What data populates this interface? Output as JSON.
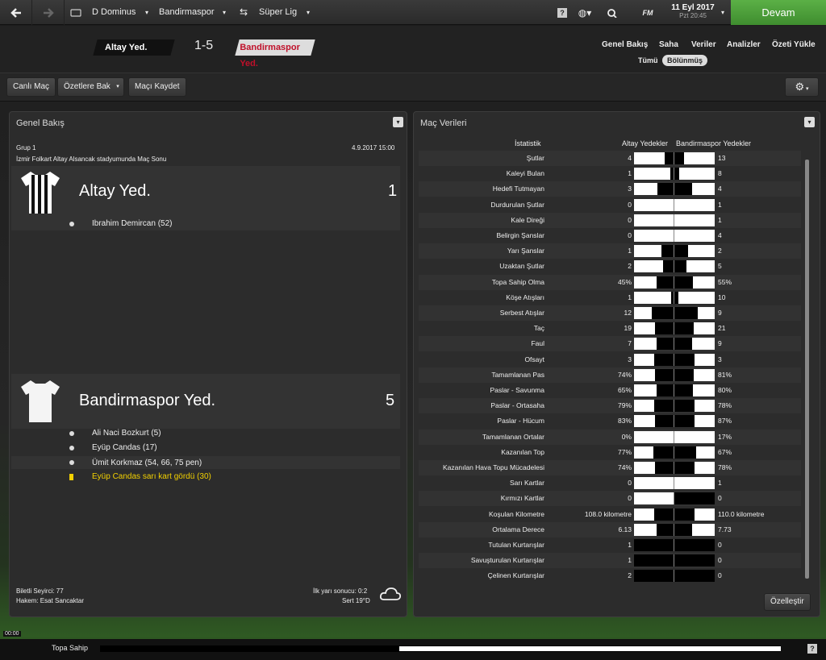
{
  "topbar": {
    "manager": "D Dominus",
    "club": "Bandirmaspor",
    "competition": "Süper Lig",
    "date": "11 Eyl 2017",
    "time": "Pzt 20:45",
    "continue": "Devam",
    "fm_label": "FM"
  },
  "match": {
    "home": "Altay Yed.",
    "away": "Bandirmaspor Yed.",
    "score": "1-5"
  },
  "nav": {
    "items": [
      "Genel Bakış",
      "Saha",
      "Veriler",
      "Analizler",
      "Özeti Yükle"
    ],
    "sub": [
      "Tümü",
      "Bölünmüş"
    ]
  },
  "toolbar": {
    "live": "Canlı Maç",
    "highlights": "Özetlere Bak",
    "save": "Maçı Kaydet"
  },
  "overview": {
    "title": "Genel Bakış",
    "group": "Grup 1",
    "datetime": "4.9.2017 15:00",
    "venue": "İzmir Folkart Altay Alsancak stadyumunda Maç Sonu",
    "home": {
      "name": "Altay Yed.",
      "score": "1",
      "events": [
        "Ibrahim Demircan (52)"
      ]
    },
    "away": {
      "name": "Bandirmaspor Yed.",
      "score": "5",
      "events": [
        "Ali Naci Bozkurt (5)",
        "Eyüp Candas (17)",
        "Ümit Korkmaz (54, 66, 75 pen)"
      ],
      "card": "Eyüp Candas sarı kart gördü (30)"
    },
    "attendance": "Biletli Seyirci: 77",
    "referee": "Hakem: Esat Sancaktar",
    "halftime": "İlk yarı sonucu: 0:2",
    "weather": "Sert 19°D"
  },
  "stats": {
    "title": "Maç Verileri",
    "col_stat": "İstatistik",
    "col_home": "Altay Yedekler",
    "col_away": "Bandirmaspor Yedekler",
    "customize": "Özelleştir",
    "rows": [
      {
        "label": "Şutlar",
        "h": "4",
        "a": "13",
        "hf": 0.24,
        "af": 0.76
      },
      {
        "label": "Kaleyi Bulan",
        "h": "1",
        "a": "8",
        "hf": 0.11,
        "af": 0.89
      },
      {
        "label": "Hedefi Tutmayan",
        "h": "3",
        "a": "4",
        "hf": 0.43,
        "af": 0.57
      },
      {
        "label": "Durdurulan Şutlar",
        "h": "0",
        "a": "1",
        "hf": 0,
        "af": 1
      },
      {
        "label": "Kale Direği",
        "h": "0",
        "a": "1",
        "hf": 0,
        "af": 1
      },
      {
        "label": "Belirgin Şanslar",
        "h": "0",
        "a": "4",
        "hf": 0,
        "af": 1
      },
      {
        "label": "Yarı Şanslar",
        "h": "1",
        "a": "2",
        "hf": 0.33,
        "af": 0.67
      },
      {
        "label": "Uzaktan Şutlar",
        "h": "2",
        "a": "5",
        "hf": 0.29,
        "af": 0.71
      },
      {
        "label": "Topa Sahip Olma",
        "h": "45%",
        "a": "55%",
        "hf": 0.45,
        "af": 0.55
      },
      {
        "label": "Köşe Atışları",
        "h": "1",
        "a": "10",
        "hf": 0.09,
        "af": 0.91
      },
      {
        "label": "Serbest Atışlar",
        "h": "12",
        "a": "9",
        "hf": 0.57,
        "af": 0.43
      },
      {
        "label": "Taç",
        "h": "19",
        "a": "21",
        "hf": 0.475,
        "af": 0.525
      },
      {
        "label": "Faul",
        "h": "7",
        "a": "9",
        "hf": 0.44,
        "af": 0.56
      },
      {
        "label": "Ofsayt",
        "h": "3",
        "a": "3",
        "hf": 0.5,
        "af": 0.5
      },
      {
        "label": "Tamamlanan Pas",
        "h": "74%",
        "a": "81%",
        "hf": 0.48,
        "af": 0.52
      },
      {
        "label": "Paslar - Savunma",
        "h": "65%",
        "a": "80%",
        "hf": 0.45,
        "af": 0.55
      },
      {
        "label": "Paslar - Ortasaha",
        "h": "79%",
        "a": "78%",
        "hf": 0.5,
        "af": 0.5
      },
      {
        "label": "Paslar - Hücum",
        "h": "83%",
        "a": "87%",
        "hf": 0.49,
        "af": 0.51
      },
      {
        "label": "Tamamlanan Ortalar",
        "h": "0%",
        "a": "17%",
        "hf": 0,
        "af": 1
      },
      {
        "label": "Kazanılan Top",
        "h": "77%",
        "a": "67%",
        "hf": 0.53,
        "af": 0.47
      },
      {
        "label": "Kazanılan Hava Topu Mücadelesi",
        "h": "74%",
        "a": "78%",
        "hf": 0.49,
        "af": 0.51
      },
      {
        "label": "Sarı Kartlar",
        "h": "0",
        "a": "1",
        "hf": 0,
        "af": 1
      },
      {
        "label": "Kırmızı Kartlar",
        "h": "0",
        "a": "0",
        "hf": 0,
        "af": 0
      },
      {
        "label": "Koşulan Kilometre",
        "h": "108.0 kilometre",
        "a": "110.0 kilometre",
        "hf": 0.495,
        "af": 0.505
      },
      {
        "label": "Ortalama Derece",
        "h": "6.13",
        "a": "7.73",
        "hf": 0.44,
        "af": 0.56
      },
      {
        "label": "Tutulan Kurtarışlar",
        "h": "1",
        "a": "0",
        "hf": 1,
        "af": 0
      },
      {
        "label": "Savuşturulan Kurtarışlar",
        "h": "1",
        "a": "0",
        "hf": 1,
        "af": 0
      },
      {
        "label": "Çelinen Kurtarışlar",
        "h": "2",
        "a": "0",
        "hf": 1,
        "af": 0
      }
    ]
  },
  "bottombar": {
    "time": "00:00",
    "label": "Topa Sahip",
    "help": "?"
  }
}
